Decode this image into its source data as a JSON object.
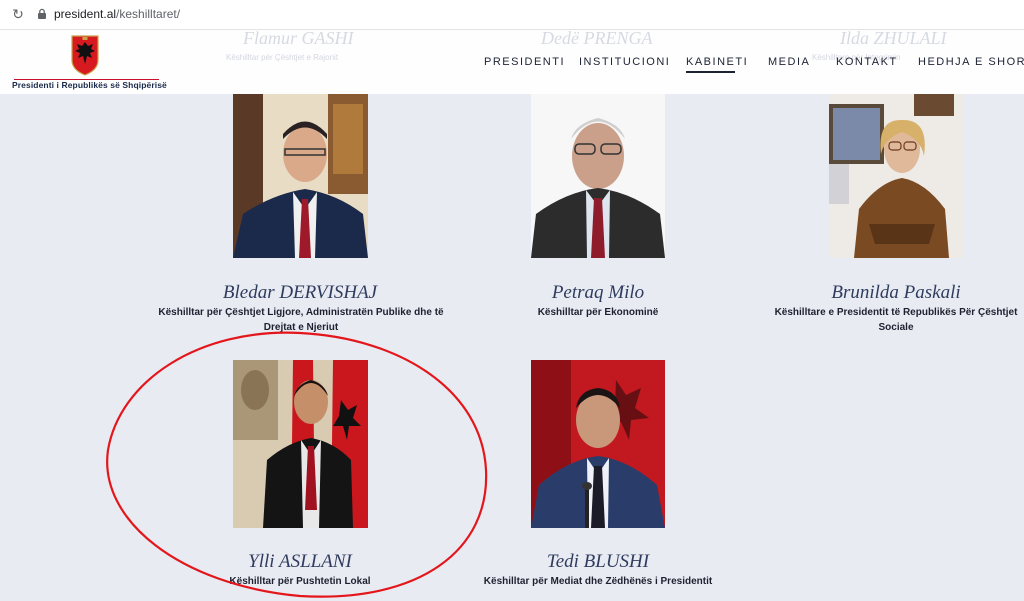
{
  "browser": {
    "url_domain": "president.al",
    "url_path": "/keshilltaret/"
  },
  "logo": {
    "text": "Presidenti i Republikës së Shqipërisë"
  },
  "nav": {
    "items": [
      "PRESIDENTI",
      "INSTITUCIONI",
      "KABINETI",
      "MEDIA",
      "KONTAKT",
      "HEDHJA E SHORTIT F"
    ],
    "active": "KABINETI"
  },
  "ghost_top": {
    "names": [
      "Flamur GASHI",
      "Dedë PRENGA",
      "Ilda ZHULALI"
    ],
    "roles": [
      "Këshilltar për Çështjet e Rajonit",
      "Këshilltare për Integrimin"
    ]
  },
  "advisors": [
    {
      "name": "Bledar DERVISHAJ",
      "role": "Këshilltar për Çështjet Ligjore, Administratën Publike dhe të Drejtat e Njeriut"
    },
    {
      "name": "Petraq Milo",
      "role": "Këshilltar për Ekonominë"
    },
    {
      "name": "Brunilda Paskali",
      "role": "Këshilltare e Presidentit të Republikës Për Çështjet Sociale"
    },
    {
      "name": "Ylli ASLLANI",
      "role": "Këshilltar  për Pushtetin Lokal"
    },
    {
      "name": "Tedi BLUSHI",
      "role": "Këshilltar për Mediat dhe Zëdhënës i Presidentit"
    }
  ],
  "colors": {
    "accent_red": "#e3171b",
    "page_bg": "#e9ebf3",
    "name_color": "#2f3c5e"
  }
}
